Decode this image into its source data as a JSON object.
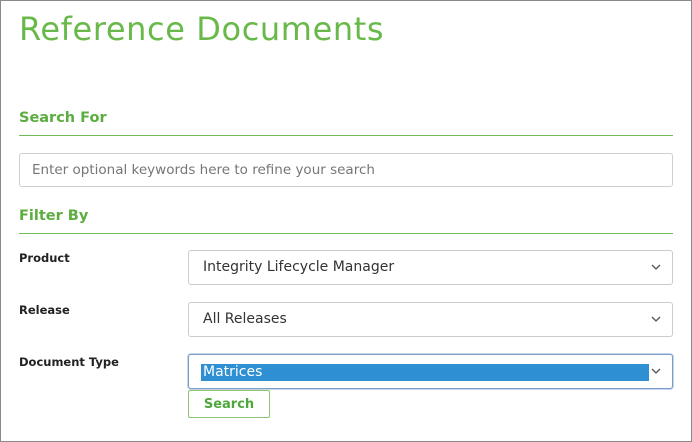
{
  "page": {
    "title": "Reference Documents"
  },
  "search": {
    "heading": "Search For",
    "placeholder": "Enter optional keywords here to refine your search",
    "value": ""
  },
  "filter": {
    "heading": "Filter By",
    "product": {
      "label": "Product",
      "selected": "Integrity Lifecycle Manager"
    },
    "release": {
      "label": "Release",
      "selected": "All Releases"
    },
    "document_type": {
      "label": "Document Type",
      "selected": "Matrices"
    }
  },
  "actions": {
    "search_label": "Search"
  },
  "colors": {
    "accent_green": "#68b94a",
    "selection_blue": "#2f8fd3"
  },
  "icons": {
    "dropdown": "chevron-down-icon"
  }
}
